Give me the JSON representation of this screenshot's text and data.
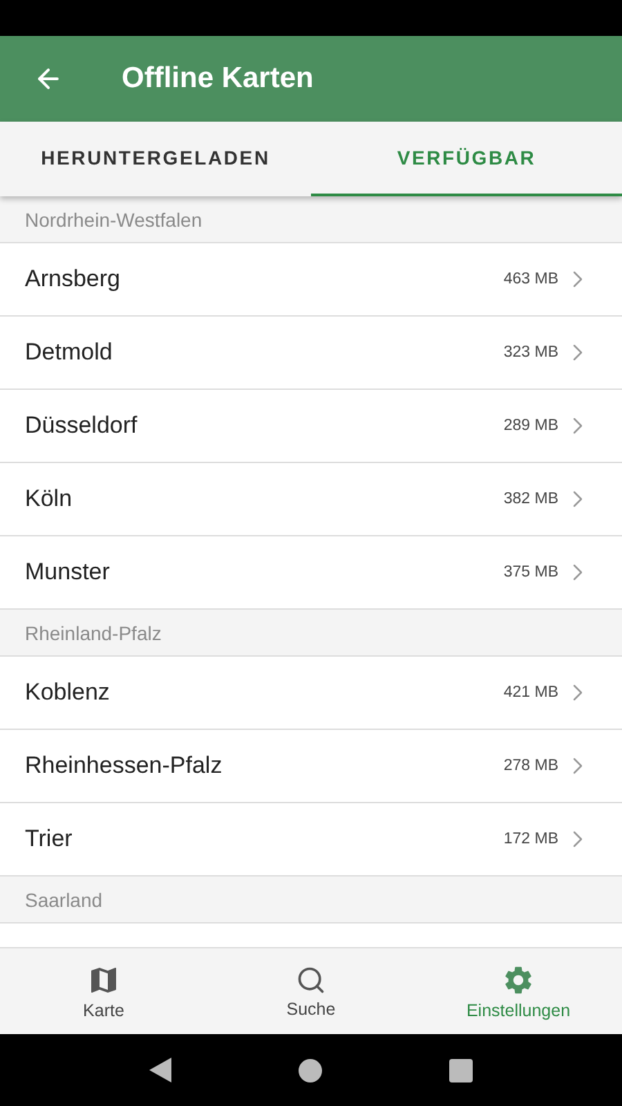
{
  "app_bar": {
    "title": "Offline Karten"
  },
  "tabs": [
    {
      "label": "HERUNTERGELADEN",
      "selected": false
    },
    {
      "label": "VERFÜGBAR",
      "selected": true
    }
  ],
  "sections": [
    {
      "title": "Nordrhein-Westfalen",
      "items": [
        {
          "name": "Arnsberg",
          "size": "463 MB"
        },
        {
          "name": "Detmold",
          "size": "323 MB"
        },
        {
          "name": "Düsseldorf",
          "size": "289 MB"
        },
        {
          "name": "Köln",
          "size": "382 MB"
        },
        {
          "name": "Munster",
          "size": "375 MB"
        }
      ]
    },
    {
      "title": "Rheinland-Pfalz",
      "items": [
        {
          "name": "Koblenz",
          "size": "421 MB"
        },
        {
          "name": "Rheinhessen-Pfalz",
          "size": "278 MB"
        },
        {
          "name": "Trier",
          "size": "172 MB"
        }
      ]
    },
    {
      "title": "Saarland"
    }
  ],
  "bottom_nav": [
    {
      "kind": "map",
      "label": "Karte",
      "selected": false
    },
    {
      "kind": "search",
      "label": "Suche",
      "selected": false
    },
    {
      "kind": "settings",
      "label": "Einstellungen",
      "selected": true
    }
  ]
}
